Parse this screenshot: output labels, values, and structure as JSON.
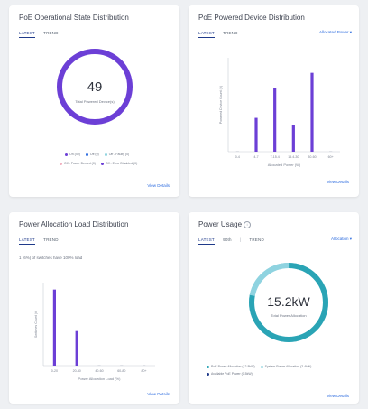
{
  "colors": {
    "purple": "#6c3fd6",
    "teal": "#2aa4b5",
    "light_blue": "#8fd3e0",
    "link_blue": "#2d6cdf",
    "ring_dark_blue": "#1f3a8a"
  },
  "card1": {
    "title": "PoE Operational State Distribution",
    "tabs": [
      "LATEST",
      "TREND"
    ],
    "center_value": "49",
    "center_label": "Total Powered Device(s)",
    "legend": [
      {
        "label": "On (49)",
        "color": "#6c3fd6"
      },
      {
        "label": "Off (0)",
        "color": "#2d6cdf"
      },
      {
        "label": "Off - Faulty (0)",
        "color": "#8fd3e0"
      },
      {
        "label": "Off - Power Denied (0)",
        "color": "#f2b0c0"
      },
      {
        "label": "Off - Error Disabled (0)",
        "color": "#6c3fd6"
      }
    ],
    "link": "View Details"
  },
  "card2": {
    "title": "PoE Powered Device Distribution",
    "tabs": [
      "LATEST",
      "TREND"
    ],
    "dropdown": "Allocated Power",
    "link": "View Details",
    "chart_data": {
      "type": "bar",
      "categories": [
        "0-4",
        "4-7",
        "7-15.4",
        "15.4-30",
        "30-60",
        "60+"
      ],
      "values": [
        0,
        9,
        17,
        7,
        21,
        0
      ],
      "xlabel": "Allocated Power (W)",
      "ylabel": "Powered Device Count (#)",
      "ylim": [
        0,
        25
      ],
      "grid": false
    }
  },
  "card3": {
    "title": "Power Allocation Load Distribution",
    "tabs": [
      "LATEST",
      "TREND"
    ],
    "note": "1 (6%) of switches have 100% load",
    "link": "View Details",
    "chart_data": {
      "type": "bar",
      "categories": [
        "0-20",
        "20-40",
        "40-60",
        "60-80",
        "80+"
      ],
      "values": [
        11,
        5,
        0,
        0,
        0
      ],
      "xlabel": "Power Allocation Load (%)",
      "ylabel": "Switches Count (#)",
      "ylim": [
        0,
        12
      ],
      "grid": false
    }
  },
  "card4": {
    "title": "Power Usage",
    "tabs": [
      "LATEST",
      "90th",
      "TREND"
    ],
    "dropdown": "Allocation",
    "center_value": "15.2kW",
    "center_label": "Total Power Allocation",
    "ring": {
      "allocated_fraction": 0.78,
      "remaining_fraction": 0.22
    },
    "legend": [
      {
        "label": "PoE Power Allocation (12.8kW)",
        "color": "#2aa4b5"
      },
      {
        "label": "System Power Allocation (2.4kW)",
        "color": "#8fd3e0"
      },
      {
        "label": "Available PoE Power (0.5kW)",
        "color": "#1f3a8a"
      }
    ],
    "link": "View Details"
  }
}
